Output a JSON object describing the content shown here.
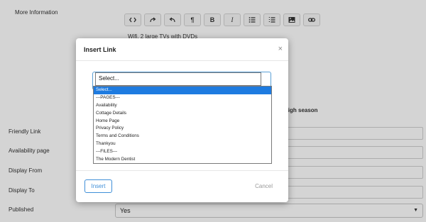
{
  "form": {
    "more_info_label": "More Information",
    "friendly_link_label": "Friendly Link",
    "availability_page_label": "Availability page",
    "display_from_label": "Display From",
    "display_to_label": "Display To",
    "published_label": "Published",
    "published_value": "Yes",
    "editor_line1": "Wifi, 2 large TVs with DVDs",
    "editor_line2": "t high season"
  },
  "toolbar": {
    "icons": [
      "code-icon",
      "redo-icon",
      "undo-icon",
      "paragraph-icon",
      "bold-icon",
      "italic-icon",
      "bulleted-list-icon",
      "numbered-list-icon",
      "image-icon",
      "link-icon"
    ],
    "paragraph_glyph": "¶",
    "bold_glyph": "B",
    "italic_glyph": "I"
  },
  "modal": {
    "title": "Insert Link",
    "close_glyph": "×",
    "select_value": "Select...",
    "options": [
      "Select...",
      "---PAGES---",
      "Availability",
      "Cottage Details",
      "Home Page",
      "Privacy Policy",
      "Terms and Conditions",
      "Thankyou",
      "---FILES---",
      "The Modern Dentist"
    ],
    "selected_index": 0,
    "insert_label": "Insert",
    "cancel_label": "Cancel"
  },
  "colors": {
    "accent": "#1e7be0",
    "button_border": "#3f8fd8",
    "overlay": "rgba(0,0,0,0.17)"
  }
}
